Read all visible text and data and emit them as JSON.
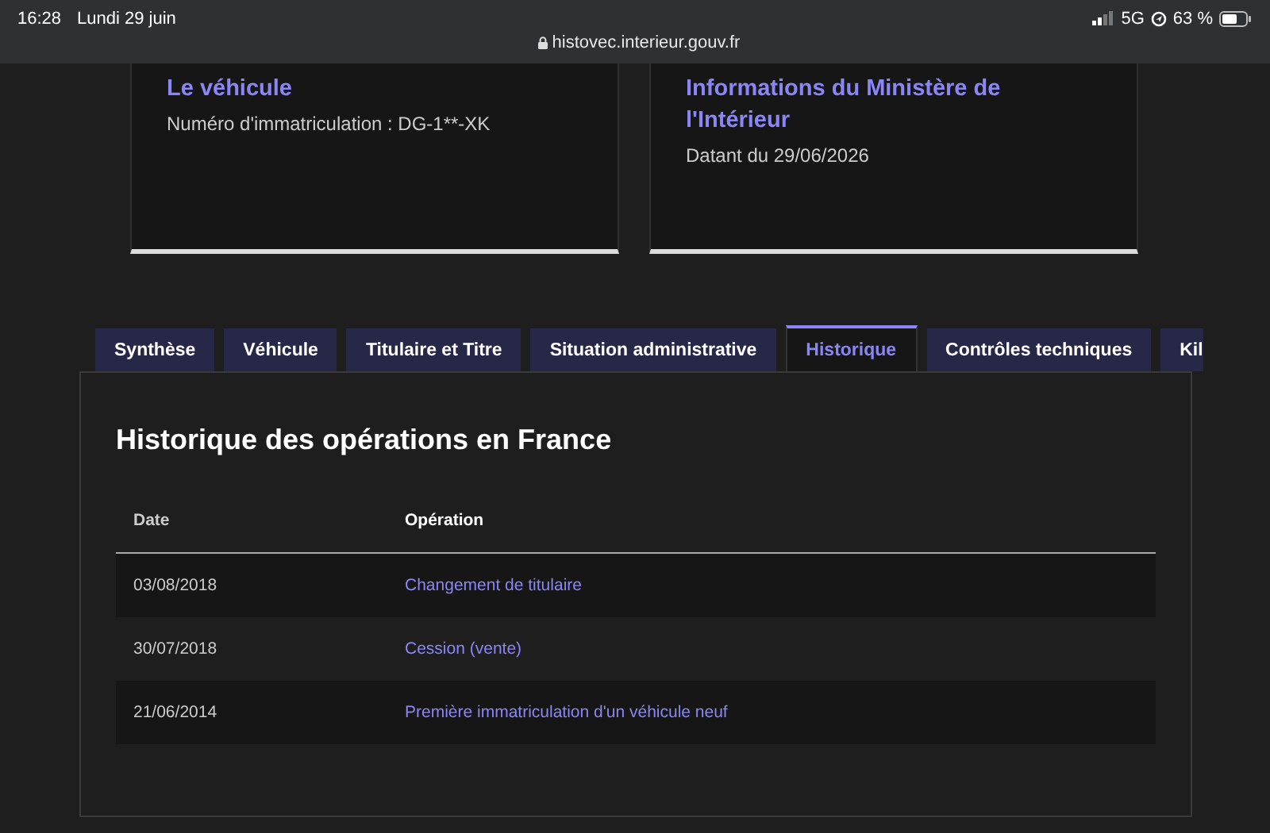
{
  "status_bar": {
    "time": "16:28",
    "date": "Lundi 29 juin",
    "network": "5G",
    "battery": "63 %",
    "url": "histovec.interieur.gouv.fr"
  },
  "cards": [
    {
      "title": "Le véhicule",
      "text": "Numéro d'immatriculation : DG-1**-XK"
    },
    {
      "title": "Informations du Ministère de l'Intérieur",
      "text": "Datant du 29/06/2026"
    }
  ],
  "tabs": [
    {
      "label": "Synthèse",
      "selected": false
    },
    {
      "label": "Véhicule",
      "selected": false
    },
    {
      "label": "Titulaire et Titre",
      "selected": false
    },
    {
      "label": "Situation administrative",
      "selected": false
    },
    {
      "label": "Historique",
      "selected": true
    },
    {
      "label": "Contrôles techniques",
      "selected": false
    },
    {
      "label": "Kil",
      "selected": false
    }
  ],
  "panel": {
    "title": "Historique des opérations en France",
    "table": {
      "columns": [
        "Date",
        "Opération"
      ],
      "rows": [
        [
          "03/08/2018",
          "Changement de titulaire"
        ],
        [
          "30/07/2018",
          "Cession (vente)"
        ],
        [
          "21/06/2014",
          "Première immatriculation d'un véhicule neuf"
        ]
      ]
    }
  }
}
